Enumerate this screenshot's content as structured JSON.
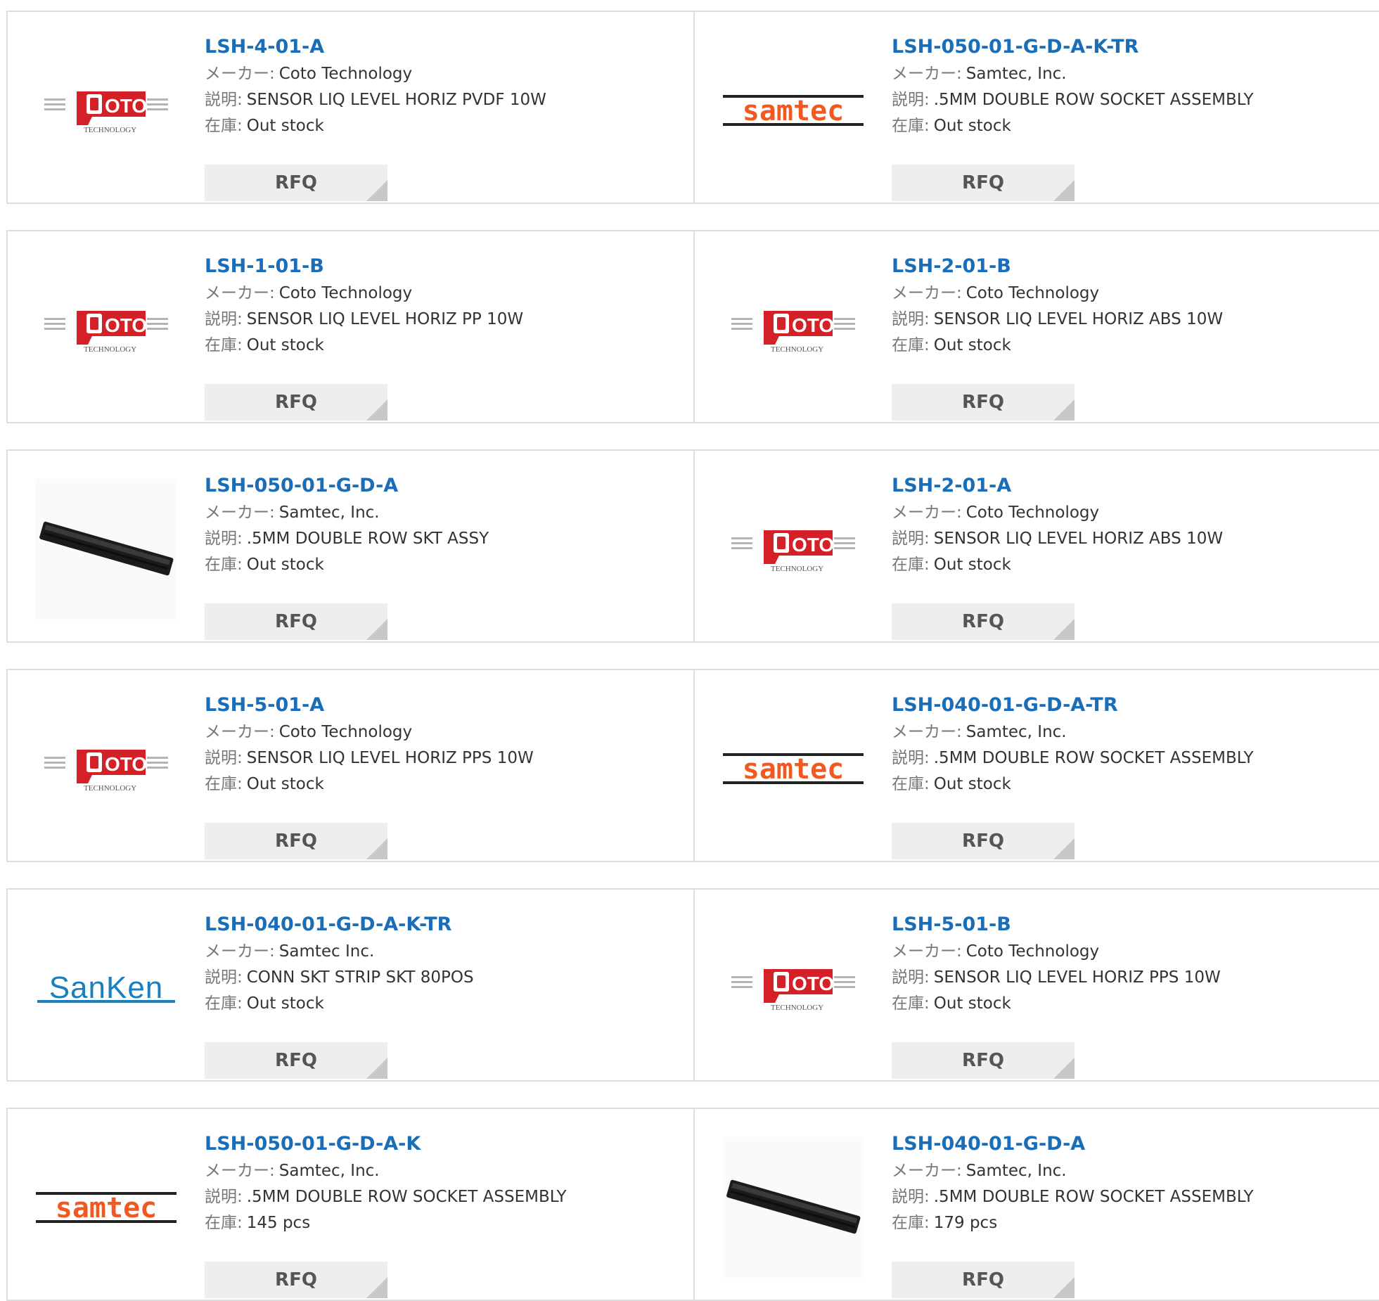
{
  "labels": {
    "maker": "メーカー:",
    "desc": "説明:",
    "stock": "在庫:",
    "rfq": "RFQ"
  },
  "logo_text": {
    "coto_main": "OTO",
    "coto_sub": "TECHNOLOGY",
    "samtec": "samtec",
    "sanken": "SanKen"
  },
  "colors": {
    "link": "#1a6db7",
    "samtec": "#f05a22",
    "sanken": "#1a7fc1",
    "coto": "#d42027"
  },
  "rows": [
    [
      {
        "logo": "coto",
        "part": "LSH-4-01-A",
        "maker": "Coto Technology",
        "desc": "SENSOR LIQ LEVEL HORIZ PVDF 10W",
        "stock": "Out stock"
      },
      {
        "logo": "samtec",
        "part": "LSH-050-01-G-D-A-K-TR",
        "maker": "Samtec, Inc.",
        "desc": ".5MM DOUBLE ROW SOCKET ASSEMBLY",
        "stock": "Out stock"
      }
    ],
    [
      {
        "logo": "coto",
        "part": "LSH-1-01-B",
        "maker": "Coto Technology",
        "desc": "SENSOR LIQ LEVEL HORIZ PP 10W",
        "stock": "Out stock"
      },
      {
        "logo": "coto",
        "part": "LSH-2-01-B",
        "maker": "Coto Technology",
        "desc": "SENSOR LIQ LEVEL HORIZ ABS 10W",
        "stock": "Out stock"
      }
    ],
    [
      {
        "logo": "socket",
        "part": "LSH-050-01-G-D-A",
        "maker": "Samtec, Inc.",
        "desc": ".5MM DOUBLE ROW SKT ASSY",
        "stock": "Out stock"
      },
      {
        "logo": "coto",
        "part": "LSH-2-01-A",
        "maker": "Coto Technology",
        "desc": "SENSOR LIQ LEVEL HORIZ ABS 10W",
        "stock": "Out stock"
      }
    ],
    [
      {
        "logo": "coto",
        "part": "LSH-5-01-A",
        "maker": "Coto Technology",
        "desc": "SENSOR LIQ LEVEL HORIZ PPS 10W",
        "stock": "Out stock"
      },
      {
        "logo": "samtec",
        "part": "LSH-040-01-G-D-A-TR",
        "maker": "Samtec, Inc.",
        "desc": ".5MM DOUBLE ROW SOCKET ASSEMBLY",
        "stock": "Out stock"
      }
    ],
    [
      {
        "logo": "sanken",
        "part": "LSH-040-01-G-D-A-K-TR",
        "maker": "Samtec Inc.",
        "desc": "CONN SKT STRIP SKT 80POS",
        "stock": "Out stock"
      },
      {
        "logo": "coto",
        "part": "LSH-5-01-B",
        "maker": "Coto Technology",
        "desc": "SENSOR LIQ LEVEL HORIZ PPS 10W",
        "stock": "Out stock"
      }
    ],
    [
      {
        "logo": "samtec",
        "part": "LSH-050-01-G-D-A-K",
        "maker": "Samtec, Inc.",
        "desc": ".5MM DOUBLE ROW SOCKET ASSEMBLY",
        "stock": "145 pcs"
      },
      {
        "logo": "socket",
        "part": "LSH-040-01-G-D-A",
        "maker": "Samtec, Inc.",
        "desc": ".5MM DOUBLE ROW SOCKET ASSEMBLY",
        "stock": "179 pcs"
      }
    ]
  ]
}
